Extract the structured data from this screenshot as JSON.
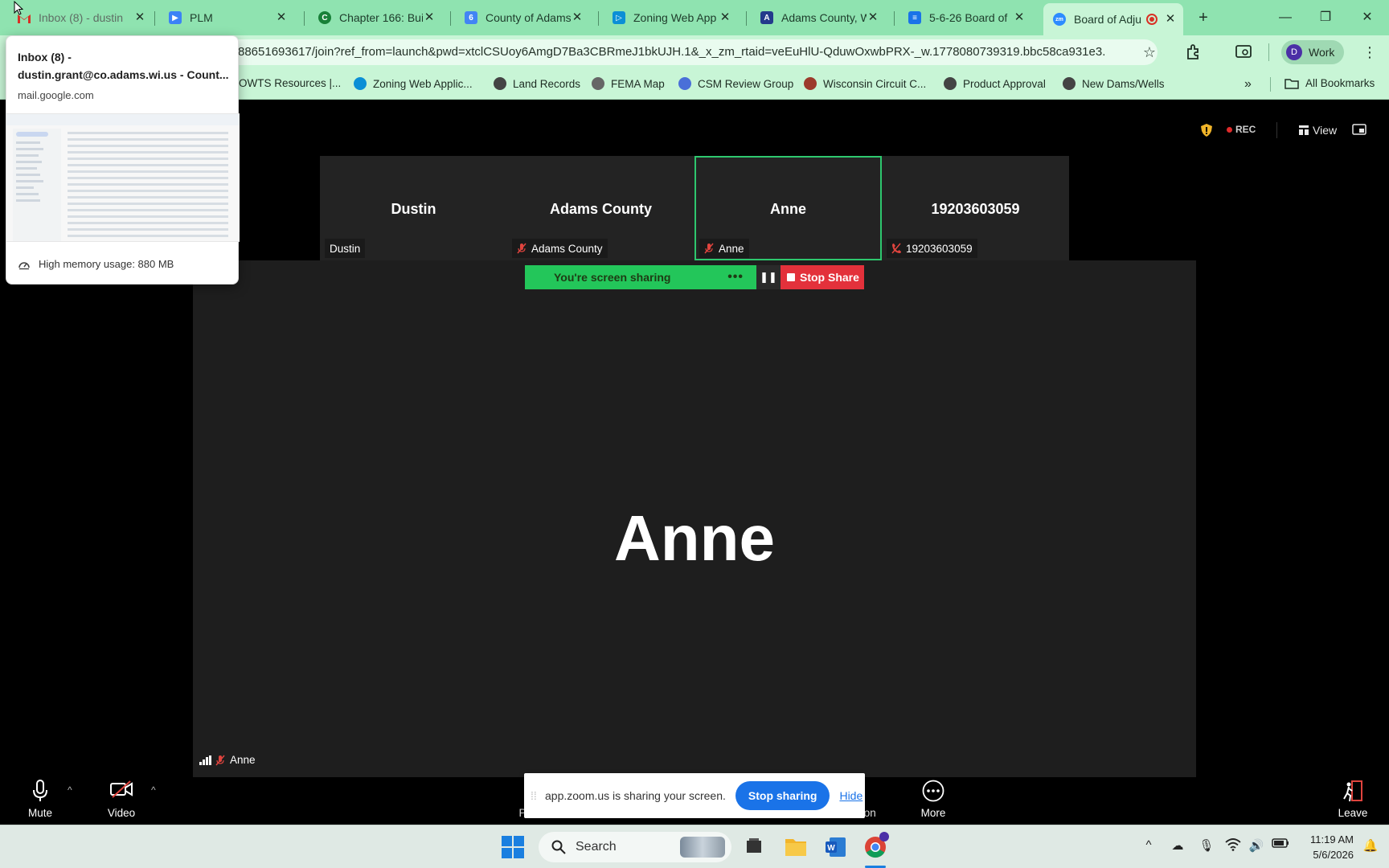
{
  "browser": {
    "tabs": [
      {
        "title": "Inbox (8) - dustin",
        "favicon": "gmail-icon",
        "color": "#d93025"
      },
      {
        "title": "PLM",
        "favicon": "plm-icon",
        "color": "#1a73e8"
      },
      {
        "title": "Chapter 166: Buil",
        "favicon": "chapter-icon",
        "color": "#188038"
      },
      {
        "title": "County of Adams",
        "favicon": "county-icon",
        "color": "#1a73e8"
      },
      {
        "title": "Zoning Web App",
        "favicon": "zoning-icon",
        "color": "#0b8fd6"
      },
      {
        "title": "Adams County, W",
        "favicon": "adams-icon",
        "color": "#233a8c"
      },
      {
        "title": "5-6-26 Board of",
        "favicon": "docs-icon",
        "color": "#1a73e8"
      },
      {
        "title": "Board of Adju",
        "favicon": "zoom-icon",
        "color": "#2d8cff",
        "active": true
      }
    ],
    "url": "88651693617/join?ref_from=launch&pwd=xtclCSUoy6AmgD7Ba3CBRmeJ1bkUJH.1&_x_zm_rtaid=veEuHlU-QduwOxwbPRX-_w.1778080739319.bbc58ca931e3...",
    "profile": {
      "initial": "D",
      "label": "Work"
    },
    "bookmarks": [
      {
        "label": "OWTS Resources |..."
      },
      {
        "label": "Zoning Web Applic..."
      },
      {
        "label": "Land Records"
      },
      {
        "label": "FEMA Map"
      },
      {
        "label": "CSM Review Group"
      },
      {
        "label": "Wisconsin Circuit C..."
      },
      {
        "label": "Product Approval"
      },
      {
        "label": "New Dams/Wells"
      }
    ],
    "all_bookmarks": "All Bookmarks"
  },
  "hovercard": {
    "line1": "Inbox (8) -",
    "line2": "dustin.grant@co.adams.wi.us - Count...",
    "domain": "mail.google.com",
    "memory": "High memory usage: 880 MB"
  },
  "zoom": {
    "rec": "REC",
    "view": "View",
    "participants": [
      {
        "name": "Dustin",
        "label": "Dustin",
        "muted": false
      },
      {
        "name": "Adams County",
        "label": "Adams County",
        "muted": true
      },
      {
        "name": "Anne",
        "label": "Anne",
        "muted": true
      },
      {
        "name": "19203603059",
        "label": "19203603059",
        "muted": true
      }
    ],
    "sharing_text": "You're screen sharing",
    "stop_share": "Stop Share",
    "main_name": "Anne",
    "main_label": "Anne",
    "toolbar": {
      "mute": "Mute",
      "video": "Video",
      "more": "More",
      "leave": "Leave",
      "partial_left": "P",
      "partial_right": "nion"
    }
  },
  "share_notice": {
    "message": "app.zoom.us is sharing your screen.",
    "stop_button": "Stop sharing",
    "hide": "Hide"
  },
  "taskbar": {
    "search": "Search",
    "time": "11:19 AM",
    "date": "5/6/2026"
  }
}
